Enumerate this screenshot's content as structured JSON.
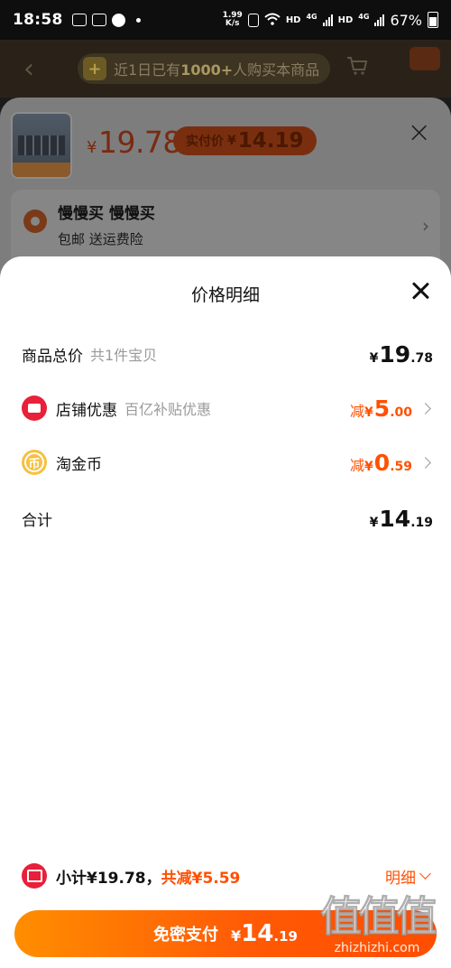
{
  "status_bar": {
    "time": "18:58",
    "net_speed_value": "1.99",
    "net_speed_unit": "K/s",
    "hd1": "HD",
    "lte1": "4G",
    "hd2": "HD",
    "lte2": "4G",
    "battery": "67%"
  },
  "background": {
    "banner_prefix": "近1日已有",
    "banner_count": "1000+",
    "banner_suffix": "人购买本商品",
    "product_price_yen": "¥",
    "product_price": "19.78",
    "real_price_label": "实付价",
    "real_price_yen": "¥",
    "real_price": "14.19",
    "address_title": "慢慢买 慢慢买",
    "address_sub": "包邮  送运费险"
  },
  "detail": {
    "title": "价格明细",
    "rows": [
      {
        "label": "商品总价",
        "sub": "共1件宝贝",
        "prefix": "",
        "yen": "¥",
        "int": "19",
        "dec": ".78"
      },
      {
        "label": "店铺优惠",
        "sub": "百亿补贴优惠",
        "prefix": "减",
        "yen": "¥",
        "int": "5",
        "dec": ".00"
      },
      {
        "label": "淘金币",
        "sub": "",
        "prefix": "减",
        "yen": "¥",
        "int": "0",
        "dec": ".59"
      },
      {
        "label": "合计",
        "sub": "",
        "prefix": "",
        "yen": "¥",
        "int": "14",
        "dec": ".19"
      }
    ],
    "coin_glyph": "币"
  },
  "footer": {
    "subtotal": "小计¥19.78，",
    "total_reduce": "共减¥5.59",
    "detail_link": "明细",
    "pay_label": "免密支付",
    "pay_yen": "¥",
    "pay_int": "14",
    "pay_dec": ".19"
  },
  "watermark": {
    "glyphs": "值值值",
    "url": "zhizhizhi.com"
  },
  "colors": {
    "accent_orange": "#ff5000",
    "brand_red": "#e8203a",
    "coin_yellow": "#f7c040"
  }
}
